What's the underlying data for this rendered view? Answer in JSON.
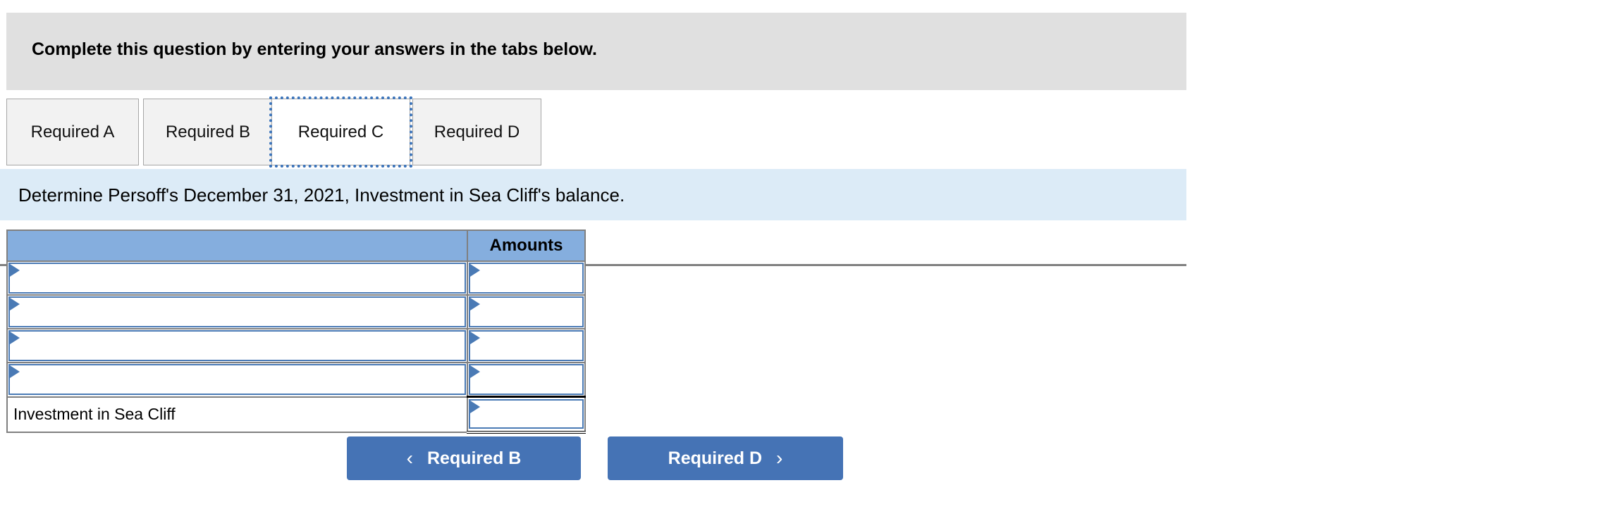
{
  "instruction": {
    "text": "Complete this question by entering your answers in the tabs below."
  },
  "tabs": [
    {
      "label": "Required A",
      "active": false
    },
    {
      "label": "Required B",
      "active": false
    },
    {
      "label": "Required C",
      "active": true
    },
    {
      "label": "Required D",
      "active": false
    }
  ],
  "prompt": {
    "text": "Determine Persoff's December 31, 2021, Investment in Sea Cliff's balance."
  },
  "table": {
    "headers": {
      "description": "",
      "amounts": "Amounts"
    },
    "rows": [
      {
        "type": "select",
        "description": "",
        "amount": ""
      },
      {
        "type": "select",
        "description": "",
        "amount": ""
      },
      {
        "type": "select",
        "description": "",
        "amount": ""
      },
      {
        "type": "select",
        "description": "",
        "amount": ""
      },
      {
        "type": "total",
        "description": "Investment in Sea Cliff",
        "amount": ""
      }
    ]
  },
  "navigation": {
    "prev_label": "Required B",
    "next_label": "Required D",
    "prev_icon": "chevron-left-icon",
    "next_icon": "chevron-right-icon",
    "prev_chevron": "‹",
    "next_chevron": "›"
  },
  "colors": {
    "instruction_band": "#e0e0e0",
    "prompt_band": "#dcebf7",
    "table_header": "#85aede",
    "field_border": "#4a7ab5",
    "button": "#4573b5",
    "tab_inactive": "#f2f2f2",
    "tab_active": "#ffffff",
    "focus_outline": "#3b74bb"
  }
}
